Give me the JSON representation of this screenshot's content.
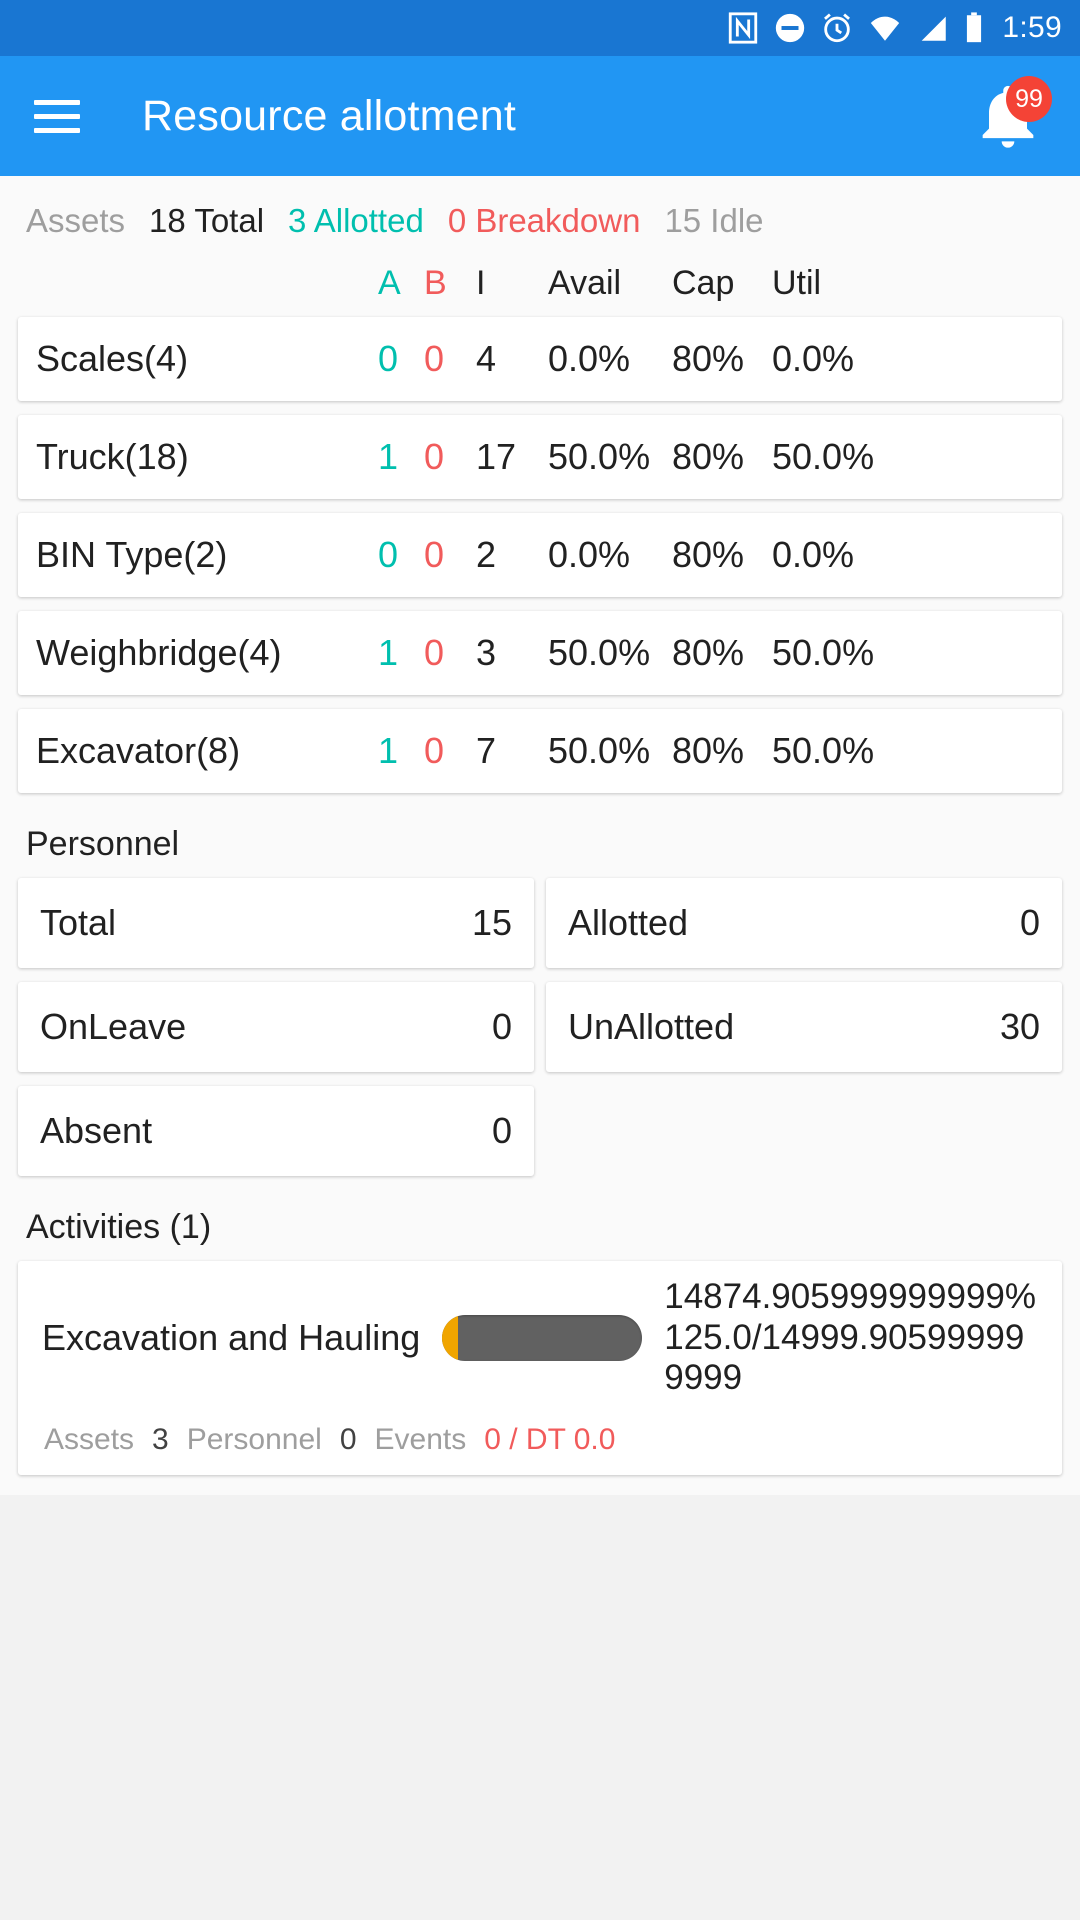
{
  "statusbar": {
    "time": "1:59",
    "icons": [
      "nfc-icon",
      "do-not-disturb-icon",
      "alarm-icon",
      "wifi-icon",
      "signal-icon",
      "battery-icon"
    ]
  },
  "appbar": {
    "menu_icon": "hamburger-menu-icon",
    "title": "Resource allotment",
    "bell_icon": "notification-bell-icon",
    "badge": "99"
  },
  "assets_summary": {
    "label": "Assets",
    "total": "18 Total",
    "allotted": "3 Allotted",
    "breakdown": "0 Breakdown",
    "idle": "15 Idle"
  },
  "assets_table": {
    "headers": {
      "name": "",
      "a": "A",
      "b": "B",
      "i": "I",
      "avail": "Avail",
      "cap": "Cap",
      "util": "Util"
    },
    "rows": [
      {
        "name": "Scales(4)",
        "a": "0",
        "b": "0",
        "i": "4",
        "avail": "0.0%",
        "cap": "80%",
        "util": "0.0%"
      },
      {
        "name": "Truck(18)",
        "a": "1",
        "b": "0",
        "i": "17",
        "avail": "50.0%",
        "cap": "80%",
        "util": "50.0%"
      },
      {
        "name": "BIN Type(2)",
        "a": "0",
        "b": "0",
        "i": "2",
        "avail": "0.0%",
        "cap": "80%",
        "util": "0.0%"
      },
      {
        "name": "Weighbridge(4)",
        "a": "1",
        "b": "0",
        "i": "3",
        "avail": "50.0%",
        "cap": "80%",
        "util": "50.0%"
      },
      {
        "name": "Excavator(8)",
        "a": "1",
        "b": "0",
        "i": "7",
        "avail": "50.0%",
        "cap": "80%",
        "util": "50.0%"
      }
    ]
  },
  "personnel": {
    "title": "Personnel",
    "cards": [
      {
        "label": "Total",
        "value": "15"
      },
      {
        "label": "Allotted",
        "value": "0"
      },
      {
        "label": "OnLeave",
        "value": "0"
      },
      {
        "label": "UnAllotted",
        "value": "30"
      },
      {
        "label": "Absent",
        "value": "0"
      }
    ]
  },
  "activities": {
    "title": "Activities (1)",
    "items": [
      {
        "name": "Excavation and Hauling",
        "progress_percent": 8,
        "stats": "14874.905999999999% 125.0/14999.905999999999",
        "footer": {
          "assets_label": "Assets",
          "assets_value": "3",
          "personnel_label": "Personnel",
          "personnel_value": "0",
          "events_label": "Events",
          "events_value": "0 / DT 0.0"
        }
      }
    ]
  },
  "colors": {
    "status_bar": "#1976d2",
    "app_bar": "#2196f3",
    "accent_teal": "#00bfae",
    "accent_red": "#f15b5b",
    "badge_red": "#f44336",
    "progress_track": "#616161",
    "progress_fill": "#f0a500"
  }
}
